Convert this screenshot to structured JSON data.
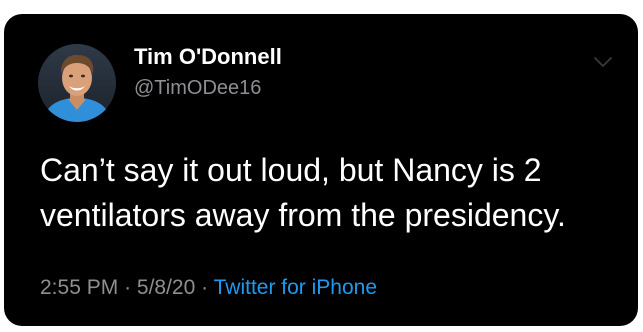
{
  "tweet": {
    "author_name": "Tim O'Donnell",
    "author_handle": "@TimODee16",
    "text": "Can’t say it out loud, but Nancy is 2 ventilators away from the presidency.",
    "time": "2:55 PM",
    "date": "5/8/20",
    "separator": "·",
    "source": "Twitter for iPhone"
  },
  "icons": {
    "avatar": "profile-photo",
    "menu": "chevron-down-icon"
  },
  "colors": {
    "background": "#000000",
    "text": "#ffffff",
    "secondary": "#8e8e93",
    "link": "#1d9bf0"
  }
}
